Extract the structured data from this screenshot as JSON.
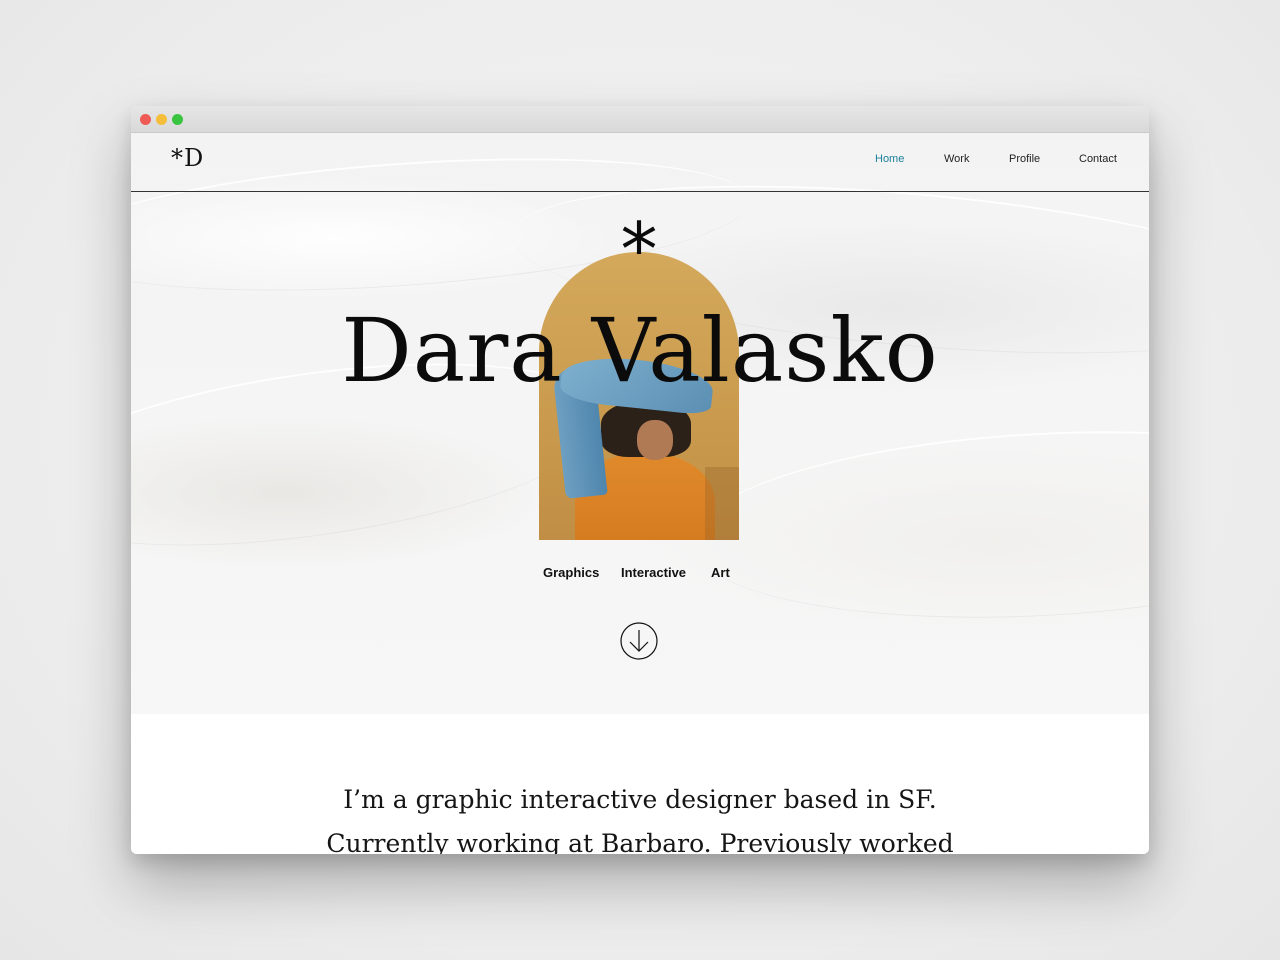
{
  "site": {
    "logo": "*D"
  },
  "nav": {
    "items": [
      {
        "label": "Home",
        "active": true
      },
      {
        "label": "Work",
        "active": false
      },
      {
        "label": "Profile",
        "active": false
      },
      {
        "label": "Contact",
        "active": false
      }
    ],
    "active_color": "#1c7f9a"
  },
  "hero": {
    "asterisk": "*",
    "name": "Dara Valasko",
    "tags": [
      "Graphics",
      "Interactive",
      "Art"
    ]
  },
  "intro": {
    "line1": "I’m a graphic interactive designer based in SF.",
    "line2": "Currently working at Barbaro. Previously worked"
  },
  "icons": {
    "scroll": "arrow-down-circle-icon"
  }
}
